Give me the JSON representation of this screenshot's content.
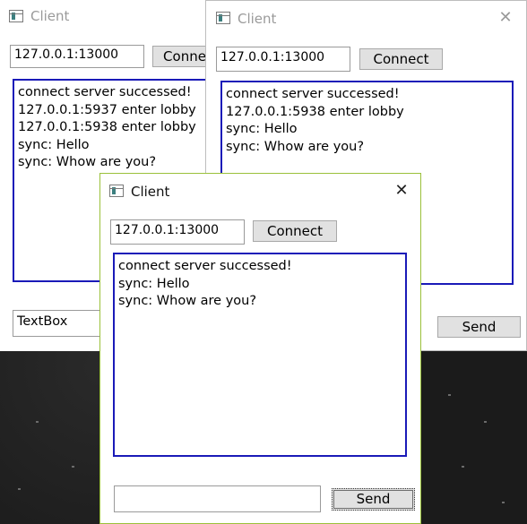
{
  "windows": [
    {
      "title": "Client",
      "address": "127.0.0.1:13000",
      "connect_label": "Conne",
      "log": [
        "connect server successed!",
        "127.0.0.1:5937 enter lobby",
        "127.0.0.1:5938 enter lobby",
        "sync: Hello",
        "sync: Whow are you?"
      ],
      "message": "TextBox"
    },
    {
      "title": "Client",
      "address": "127.0.0.1:13000",
      "connect_label": "Connect",
      "log": [
        "connect server successed!",
        "127.0.0.1:5938 enter lobby",
        "sync: Hello",
        "sync: Whow are you?"
      ],
      "send_label": "Send"
    },
    {
      "title": "Client",
      "address": "127.0.0.1:13000",
      "connect_label": "Connect",
      "log": [
        "connect server successed!",
        "sync: Hello",
        "sync: Whow are you?"
      ],
      "message": "",
      "send_label": "Send"
    }
  ],
  "icons": {
    "app": "window-app-icon",
    "close": "close-icon"
  },
  "colors": {
    "log_border": "#1a1ab8",
    "active_border": "#9ac13a"
  }
}
